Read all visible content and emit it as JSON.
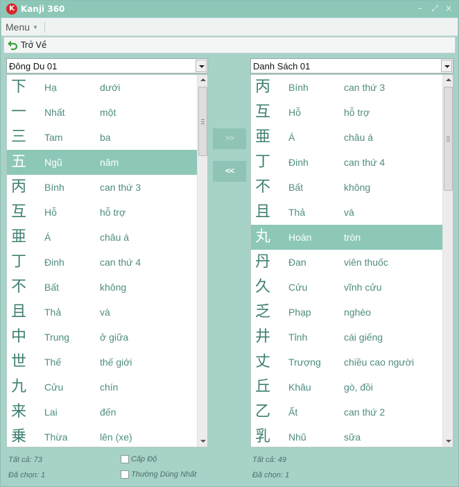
{
  "window": {
    "title": "Kanji 360",
    "logo_letter": "K",
    "minimize_glyph": "–",
    "maximize_glyph": "⤢",
    "close_glyph": "×"
  },
  "menubar": {
    "menu_label": "Menu",
    "menu_caret": "▼"
  },
  "toolbar": {
    "back_label": "Trở Về"
  },
  "left_panel": {
    "combo_value": "Đông Du 01",
    "items": [
      {
        "kanji": "下",
        "reading": "Hạ",
        "meaning": "dưới"
      },
      {
        "kanji": "一",
        "reading": "Nhất",
        "meaning": "một"
      },
      {
        "kanji": "三",
        "reading": "Tam",
        "meaning": "ba"
      },
      {
        "kanji": "五",
        "reading": "Ngũ",
        "meaning": "năm"
      },
      {
        "kanji": "丙",
        "reading": "Bính",
        "meaning": "can thứ 3"
      },
      {
        "kanji": "互",
        "reading": "Hỗ",
        "meaning": "hỗ trợ"
      },
      {
        "kanji": "亜",
        "reading": "Á",
        "meaning": "châu á"
      },
      {
        "kanji": "丁",
        "reading": "Đinh",
        "meaning": "can thứ 4"
      },
      {
        "kanji": "不",
        "reading": "Bất",
        "meaning": "không"
      },
      {
        "kanji": "且",
        "reading": "Thả",
        "meaning": "và"
      },
      {
        "kanji": "中",
        "reading": "Trung",
        "meaning": "ở giữa"
      },
      {
        "kanji": "世",
        "reading": "Thế",
        "meaning": "thế giới"
      },
      {
        "kanji": "九",
        "reading": "Cửu",
        "meaning": "chín"
      },
      {
        "kanji": "来",
        "reading": "Lai",
        "meaning": "đến"
      },
      {
        "kanji": "乗",
        "reading": "Thừa",
        "meaning": "lên (xe)"
      }
    ],
    "selected_index": 3,
    "total_label": "Tất cả: 73",
    "selected_label": "Đã chọn: 1"
  },
  "right_panel": {
    "combo_value": "Danh Sách 01",
    "items": [
      {
        "kanji": "丙",
        "reading": "Bính",
        "meaning": "can thứ 3"
      },
      {
        "kanji": "互",
        "reading": "Hỗ",
        "meaning": "hỗ trợ"
      },
      {
        "kanji": "亜",
        "reading": "Á",
        "meaning": "châu á"
      },
      {
        "kanji": "丁",
        "reading": "Đinh",
        "meaning": "can thứ 4"
      },
      {
        "kanji": "不",
        "reading": "Bất",
        "meaning": "không"
      },
      {
        "kanji": "且",
        "reading": "Thả",
        "meaning": "và"
      },
      {
        "kanji": "丸",
        "reading": "Hoàn",
        "meaning": "tròn"
      },
      {
        "kanji": "丹",
        "reading": "Đan",
        "meaning": "viên thuốc"
      },
      {
        "kanji": "久",
        "reading": "Cửu",
        "meaning": "vĩnh cửu"
      },
      {
        "kanji": "乏",
        "reading": "Phạp",
        "meaning": "nghèo"
      },
      {
        "kanji": "井",
        "reading": "Tỉnh",
        "meaning": "cái giếng"
      },
      {
        "kanji": "丈",
        "reading": "Trượng",
        "meaning": "chiều cao người"
      },
      {
        "kanji": "丘",
        "reading": "Khâu",
        "meaning": "gò, đồi"
      },
      {
        "kanji": "乙",
        "reading": "Ất",
        "meaning": "can thứ 2"
      },
      {
        "kanji": "乳",
        "reading": "Nhũ",
        "meaning": "sữa"
      }
    ],
    "selected_index": 6,
    "total_label": "Tất cả: 49",
    "selected_label": "Đã chọn: 1"
  },
  "move_buttons": {
    "add_label": ">>",
    "remove_label": "<<"
  },
  "filters": {
    "level_label": "Cấp Độ",
    "common_label": "Thường Dùng Nhất"
  },
  "colors": {
    "window_bg": "#a6d2c8",
    "selection": "#8cc7b8",
    "text": "#4d8c80",
    "kanji": "#3f7f72"
  },
  "icons": {
    "back": "undo-arrow-icon",
    "logo": "kanji-logo-icon"
  }
}
